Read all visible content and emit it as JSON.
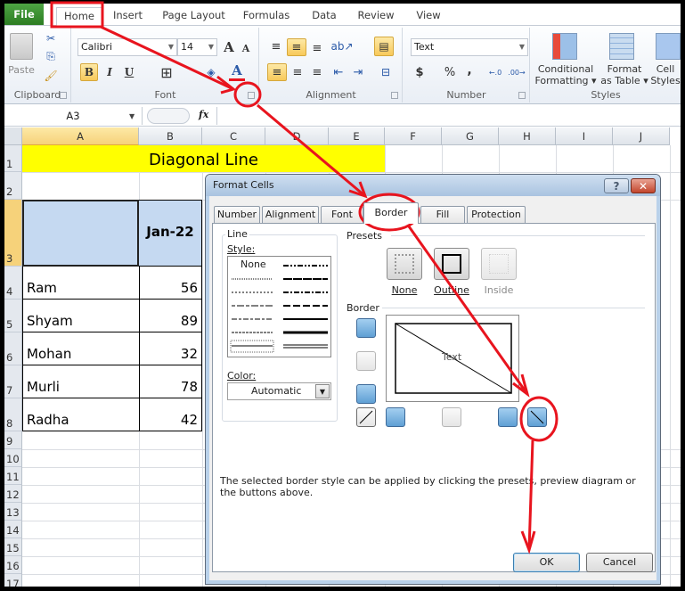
{
  "ribbon_tabs": [
    "File",
    "Home",
    "Insert",
    "Page Layout",
    "Formulas",
    "Data",
    "Review",
    "View"
  ],
  "active_tab": "Home",
  "clipboard": {
    "paste_label": "Paste",
    "group_label": "Clipboard"
  },
  "font": {
    "name": "Calibri",
    "size": "14",
    "group_label": "Font",
    "bold_label": "B",
    "italic_label": "I",
    "underline_label": "U",
    "grow_label": "A",
    "shrink_label": "A",
    "font_color_label": "A"
  },
  "alignment": {
    "group_label": "Alignment"
  },
  "number": {
    "format": "Text",
    "group_label": "Number",
    "currency_label": "$",
    "percent_label": "%",
    "comma_label": ",",
    "inc_decimal_label": ".0→.00",
    "dec_decimal_label": ".00→.0"
  },
  "styles": {
    "conditional_label_1": "Conditional",
    "conditional_label_2": "Formatting ▾",
    "format_table_label_1": "Format",
    "format_table_label_2": "as Table ▾",
    "cell_styles_label_1": "Cell",
    "cell_styles_label_2": "Styles",
    "group_label": "Styles"
  },
  "formula_bar": {
    "name_box": "A3",
    "fx_label": "fx",
    "formula": ""
  },
  "columns": [
    "A",
    "B",
    "C",
    "D",
    "E",
    "F",
    "G",
    "H",
    "I",
    "J"
  ],
  "rows": [
    "1",
    "2",
    "3",
    "4",
    "5",
    "6",
    "7",
    "8",
    "9",
    "10",
    "11",
    "12",
    "13",
    "14",
    "15",
    "16",
    "17"
  ],
  "sheet": {
    "title": "Diagonal Line",
    "header_b3": "Jan-22",
    "data": [
      {
        "name": "Ram",
        "value": "56"
      },
      {
        "name": "Shyam",
        "value": "89"
      },
      {
        "name": "Mohan",
        "value": "32"
      },
      {
        "name": "Murli",
        "value": "78"
      },
      {
        "name": "Radha",
        "value": "42"
      }
    ]
  },
  "dialog": {
    "title": "Format Cells",
    "help_label": "?",
    "close_label": "✕",
    "tabs": [
      "Number",
      "Alignment",
      "Font",
      "Border",
      "Fill",
      "Protection"
    ],
    "active_tab": "Border",
    "line_label": "Line",
    "style_label": "Style:",
    "style_none": "None",
    "color_label": "Color:",
    "color_value": "Automatic",
    "presets_label": "Presets",
    "preset_none": "None",
    "preset_outline": "Outline",
    "preset_inside": "Inside",
    "border_label": "Border",
    "preview_text": "Text",
    "hint": "The selected border style can be applied by clicking the presets, preview diagram or the buttons above.",
    "ok_label": "OK",
    "cancel_label": "Cancel"
  },
  "colors": {
    "annotation": "#e8141e",
    "title_fill": "#ffff00",
    "header_fill": "#c5d9f1",
    "file_tab": "#2c7d22"
  }
}
